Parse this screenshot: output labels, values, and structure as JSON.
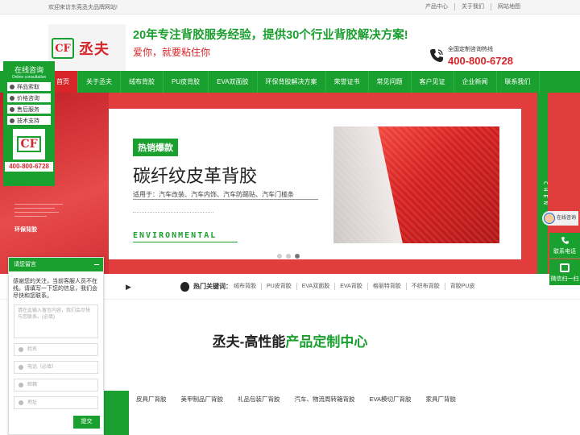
{
  "topbar": {
    "welcome": "欢迎来访东莞丞夫品牌网站!",
    "links": [
      "产品中心",
      "关于我们",
      "网站地图"
    ]
  },
  "header": {
    "logo_mark": "CF",
    "logo_name": "丞夫",
    "slogan_main": "20年专注背胶服务经验，提供30个行业背胶解决方案!",
    "slogan_sub": "爱你，就要粘住你",
    "hotline_label": "全国定制咨询热线",
    "hotline_number": "400-800-6728"
  },
  "nav": {
    "items": [
      "首页",
      "关于丞夫",
      "绒布背胶",
      "PU皮背胶",
      "EVA双面胶",
      "环保背胶解决方案",
      "荣誉证书",
      "常见问题",
      "客户见证",
      "企业新闻",
      "联系我们"
    ],
    "active_index": 0
  },
  "banner": {
    "left_label": "环保背胶",
    "tag": "热销爆款",
    "title": "碳纤纹皮革背胶",
    "subtitle": "适用于：汽车改装、汽车内饰、汽车防踢贴、汽车门槛条",
    "env": "ENVIRONMENTAL",
    "stripe": "CHEN FU",
    "slides": 3,
    "active_slide": 3
  },
  "keywords": {
    "label": "热门关键词：",
    "items": [
      "绒布背胶",
      "PU皮背胶",
      "EVA双面胶",
      "EVA背胶",
      "格丽特背胶",
      "不织布背胶",
      "背胶PU皮"
    ]
  },
  "section": {
    "title_dark": "丞夫-高性能",
    "title_green": "产品定制中心",
    "categories": [
      "皮具厂背胶",
      "美甲制品厂背胶",
      "礼品包装厂背胶",
      "汽车、物流周转箱背胶",
      "EVA模切厂背胶",
      "家具厂背胶"
    ]
  },
  "float_left": {
    "title": "在线咨询",
    "subtitle": "Online consultation",
    "buttons": [
      "样品索取",
      "价格咨询",
      "售后服务",
      "技术支持"
    ],
    "logo": "CF",
    "phone": "400-800-6728"
  },
  "chat": {
    "title": "请您留言",
    "message": "感谢您的关注，当前客服人员不在线。请填写一下您的信息，我们会尽快和您联系。",
    "textarea_placeholder": "请在此输入留言内容，我们会尽快与您联系。(必填)",
    "fields": [
      "姓名",
      "电话（必填）",
      "邮箱",
      "地址"
    ],
    "submit": "提交"
  },
  "float_right": {
    "online": "在线咨询",
    "phone": "联系电话",
    "wechat": "微信扫一扫"
  },
  "colors": {
    "brand_green": "#1aa02f",
    "brand_red": "#d8252a"
  }
}
